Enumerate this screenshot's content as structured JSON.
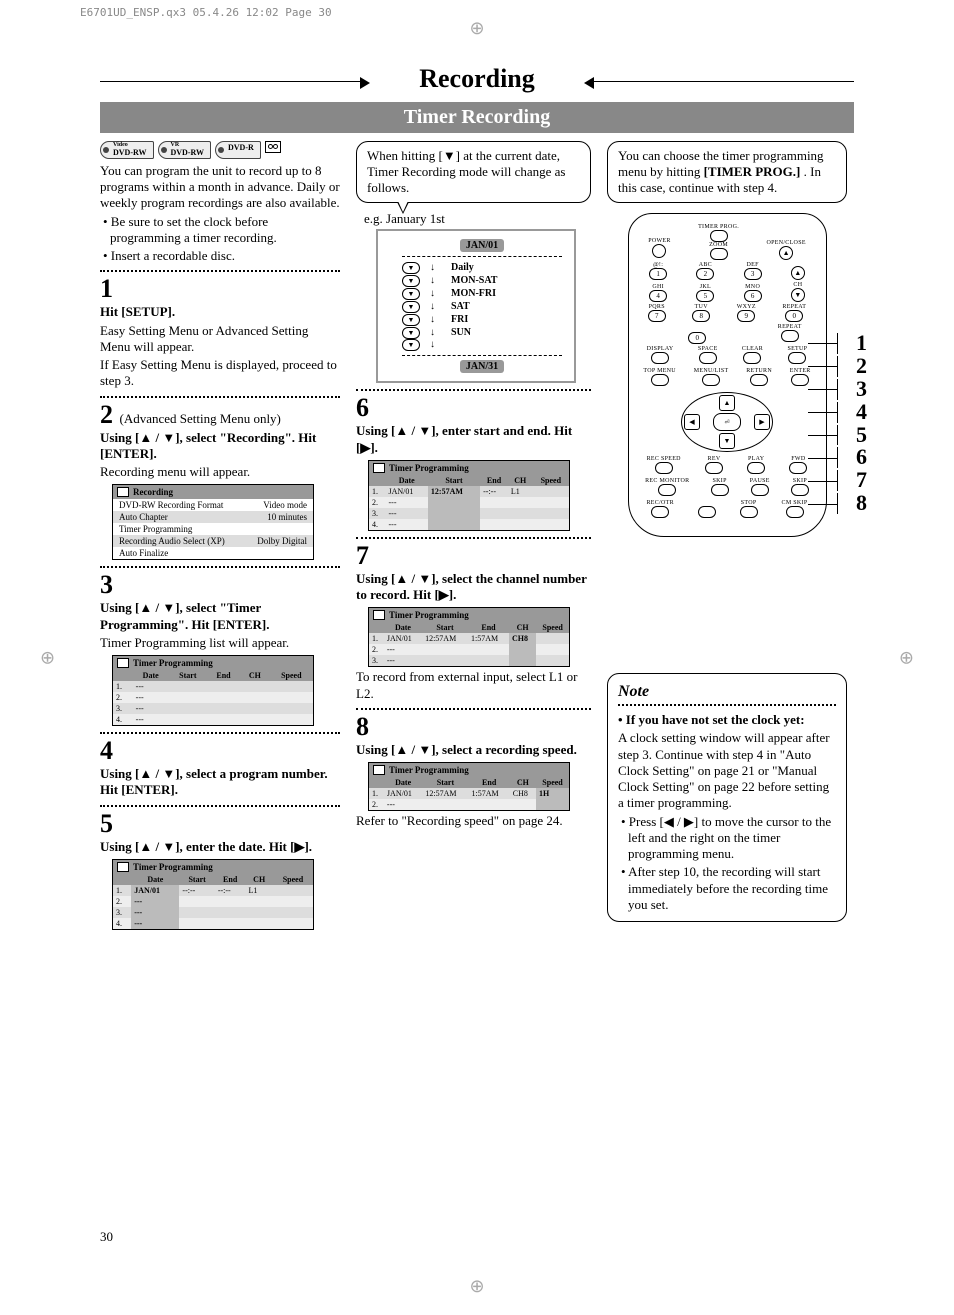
{
  "meta": {
    "header_mark": "E6701UD_ENSP.qx3  05.4.26 12:02  Page 30",
    "page_number": "30"
  },
  "title": "Recording",
  "subtitle": "Timer Recording",
  "badges": [
    "DVD-RW",
    "DVD-RW",
    "DVD-R"
  ],
  "intro": {
    "p1": "You can program the unit to record up to 8 programs within a month in advance. Daily or weekly program recordings are also available.",
    "b1": "• Be sure to set the clock before programming a timer recording.",
    "b2": "• Insert a recordable disc."
  },
  "steps": {
    "s1": {
      "num": "1",
      "head": "Hit [SETUP].",
      "body1": "Easy Setting Menu or Advanced Setting Menu will appear.",
      "body2": "If Easy Setting Menu is displayed, proceed to step 3."
    },
    "s2": {
      "num": "2",
      "inline": "(Advanced Setting Menu only)",
      "head": "Using [▲ / ▼], select \"Recording\". Hit [ENTER].",
      "body1": "Recording menu will appear."
    },
    "s3": {
      "num": "3",
      "head": "Using [▲ / ▼], select \"Timer Programming\". Hit [ENTER].",
      "body1": "Timer Programming list will appear."
    },
    "s4": {
      "num": "4",
      "head": "Using [▲ / ▼], select a program number. Hit [ENTER]."
    },
    "s5": {
      "num": "5",
      "head": "Using [▲ / ▼], enter the date. Hit [▶]."
    },
    "s6": {
      "num": "6",
      "head": "Using [▲ / ▼], enter start and end. Hit [▶]."
    },
    "s7": {
      "num": "7",
      "head": "Using [▲ / ▼], select the channel number to record. Hit [▶].",
      "body1": "To record from external input, select L1 or L2."
    },
    "s8": {
      "num": "8",
      "head": "Using [▲ / ▼], select a recording speed.",
      "body1": "Refer to \"Recording speed\" on page 24."
    }
  },
  "osd_recording": {
    "title": "Recording",
    "rows": [
      {
        "l": "DVD-RW Recording Format",
        "r": "Video mode"
      },
      {
        "l": "Auto Chapter",
        "r": "10 minutes"
      },
      {
        "l": "Timer Programming",
        "r": ""
      },
      {
        "l": "Recording Audio Select (XP)",
        "r": "Dolby Digital"
      },
      {
        "l": "Auto Finalize",
        "r": ""
      }
    ]
  },
  "osd_tp_headers": [
    "",
    "Date",
    "Start",
    "End",
    "CH",
    "Speed"
  ],
  "osd_tp_title": "Timer Programming",
  "osd_tp3": {
    "rows": [
      [
        "1.",
        "---",
        "",
        "",
        "",
        ""
      ],
      [
        "2.",
        "---",
        "",
        "",
        "",
        ""
      ],
      [
        "3.",
        "---",
        "",
        "",
        "",
        ""
      ],
      [
        "4.",
        "---",
        "",
        "",
        "",
        ""
      ]
    ]
  },
  "osd_tp5": {
    "rows": [
      [
        "1.",
        "JAN/01",
        "--:--",
        "--:--",
        "L1",
        ""
      ],
      [
        "2.",
        "---",
        "",
        "",
        "",
        ""
      ],
      [
        "3.",
        "---",
        "",
        "",
        "",
        ""
      ],
      [
        "4.",
        "---",
        "",
        "",
        "",
        ""
      ]
    ],
    "hl_col": 1
  },
  "osd_tp6": {
    "rows": [
      [
        "1.",
        "JAN/01",
        "12:57AM",
        "--:--",
        "L1",
        ""
      ],
      [
        "2.",
        "---",
        "",
        "",
        "",
        ""
      ],
      [
        "3.",
        "---",
        "",
        "",
        "",
        ""
      ],
      [
        "4.",
        "---",
        "",
        "",
        "",
        ""
      ]
    ],
    "hl_col": 2
  },
  "osd_tp7": {
    "rows": [
      [
        "1.",
        "JAN/01",
        "12:57AM",
        "1:57AM",
        "CH8",
        ""
      ],
      [
        "2.",
        "---",
        "",
        "",
        "",
        ""
      ],
      [
        "3.",
        "---",
        "",
        "",
        "",
        ""
      ]
    ],
    "hl_col": 4
  },
  "osd_tp8": {
    "rows": [
      [
        "1.",
        "JAN/01",
        "12:57AM",
        "1:57AM",
        "CH8",
        "1H"
      ],
      [
        "2.",
        "---",
        "",
        "",
        "",
        ""
      ]
    ],
    "hl_col": 5
  },
  "tip_mid": {
    "text": "When hitting [▼] at the current date, Timer Recording mode will change as follows.",
    "eg": "e.g. January 1st"
  },
  "cycle": {
    "top": "JAN/01",
    "items": [
      "Daily",
      "MON-SAT",
      "MON-FRI",
      "SAT",
      "FRI",
      "SUN"
    ],
    "bottom": "JAN/31"
  },
  "tip_right": {
    "p1": "You can choose the timer programming menu by hitting ",
    "bold": "[TIMER PROG.]",
    "p2": " .  In this case, continue with step 4."
  },
  "remote": {
    "top": {
      "power": "POWER",
      "timer": "TIMER PROG.",
      "open": "OPEN/CLOSE",
      "zoom": "ZOOM"
    },
    "keypad_labels": [
      "@!:",
      "ABC",
      "DEF",
      "GHI",
      "JKL",
      "MNO",
      "CH",
      "PQRS",
      "TUV",
      "WXYZ",
      "REPEAT"
    ],
    "keypad_nums": [
      "1",
      "2",
      "3",
      "4",
      "5",
      "6",
      "7",
      "8",
      "9",
      "0"
    ],
    "row_mid": [
      "DISPLAY",
      "SPACE",
      "CLEAR",
      "SETUP"
    ],
    "row_menu": [
      "TOP MENU",
      "MENU/LIST",
      "RETURN",
      "ENTER"
    ],
    "transport1": [
      "REC SPEED",
      "REV",
      "PLAY",
      "FWD"
    ],
    "transport2": [
      "REC MONITOR",
      "SKIP",
      "PAUSE",
      "SKIP"
    ],
    "transport3": [
      "REC/OTR",
      "",
      "STOP",
      "CM SKIP"
    ]
  },
  "remote_callouts": [
    "1",
    "2",
    "3",
    "4",
    "5",
    "6",
    "7",
    "8"
  ],
  "note": {
    "title": "Note",
    "head": "• If you have not set the clock yet:",
    "p1": "A clock setting window will appear after step 3.  Continue with step 4 in \"Auto Clock Setting\" on page 21 or \"Manual Clock Setting\" on page 22 before setting a timer programming.",
    "b2": "• Press [◀ / ▶] to move the cursor to the left and the right on the timer programming menu.",
    "b3": "• After step 10, the recording will start immediately before the recording time you set."
  }
}
